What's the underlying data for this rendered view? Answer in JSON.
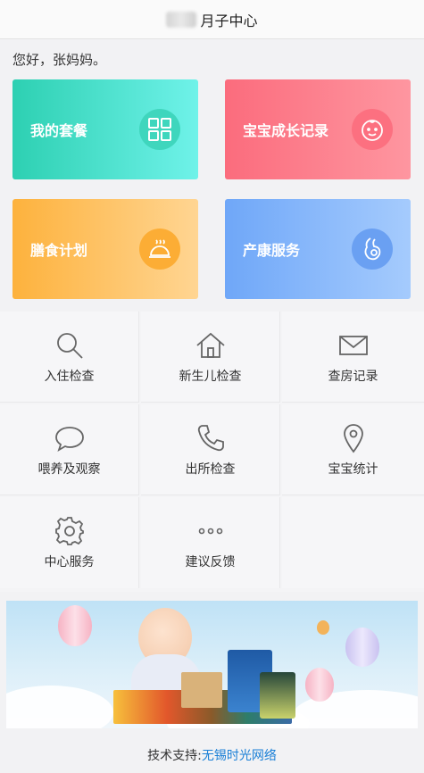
{
  "header": {
    "title": "月子中心"
  },
  "greeting": "您好，张妈妈。",
  "cards": [
    {
      "label": "我的套餐",
      "icon": "grid-icon"
    },
    {
      "label": "宝宝成长记录",
      "icon": "baby-face-icon"
    },
    {
      "label": "膳食计划",
      "icon": "food-cloche-icon"
    },
    {
      "label": "产康服务",
      "icon": "pregnancy-icon"
    }
  ],
  "menu": [
    {
      "label": "入住检查",
      "icon": "search-icon"
    },
    {
      "label": "新生儿检查",
      "icon": "home-icon"
    },
    {
      "label": "查房记录",
      "icon": "mail-icon"
    },
    {
      "label": "喂养及观察",
      "icon": "chat-bubble-icon"
    },
    {
      "label": "出所检查",
      "icon": "phone-icon"
    },
    {
      "label": "宝宝统计",
      "icon": "location-pin-icon"
    },
    {
      "label": "中心服务",
      "icon": "gear-icon"
    },
    {
      "label": "建议反馈",
      "icon": "more-dots-icon"
    }
  ],
  "footer": {
    "prefix": "技术支持:",
    "company": "无锡时光网络"
  }
}
